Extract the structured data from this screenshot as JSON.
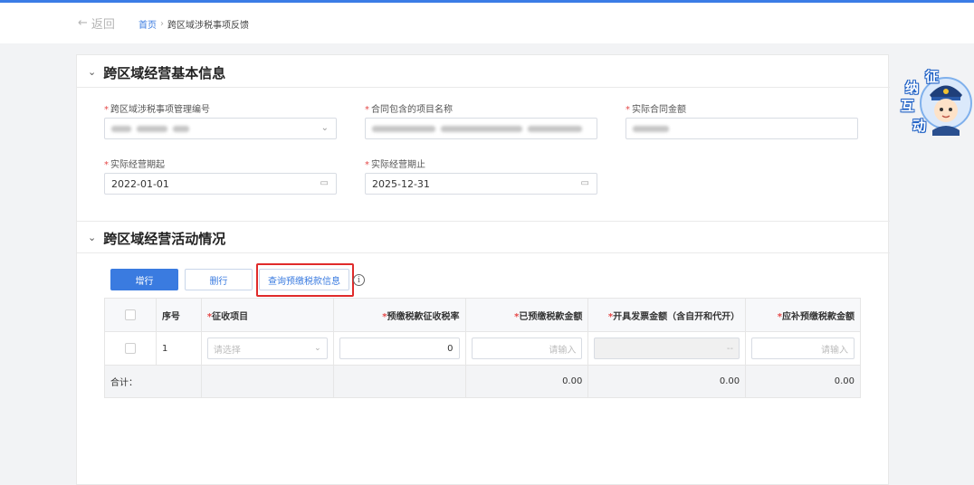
{
  "header": {
    "back_label": "返回",
    "breadcrumb": {
      "home": "首页",
      "separator": "›",
      "current": "跨区域涉税事项反馈"
    }
  },
  "section_basic": {
    "title": "跨区域经营基本信息",
    "fields": {
      "mgmt_no": {
        "label": "跨区域涉税事项管理编号",
        "value": ""
      },
      "project_name": {
        "label": "合同包含的项目名称",
        "value": ""
      },
      "contract_amount": {
        "label": "实际合同金额",
        "value": ""
      },
      "period_start": {
        "label": "实际经营期起",
        "value": "2022-01-01"
      },
      "period_end": {
        "label": "实际经营期止",
        "value": "2025-12-31"
      }
    }
  },
  "section_activity": {
    "title": "跨区域经营活动情况",
    "buttons": {
      "add": "增行",
      "delete": "删行",
      "query": "查询预缴税款信息"
    },
    "info_icon": "ⓘ",
    "table": {
      "headers": {
        "index": "序号",
        "item": "征收项目",
        "rate": "预缴税款征收税率",
        "prepaid": "已预缴税款金额",
        "invoice": "开具发票金额（含自开和代开）",
        "supplement": "应补预缴税款金额"
      },
      "required_mark": "*",
      "row": {
        "index": "1",
        "item_placeholder": "请选择",
        "rate": "0",
        "prepaid_placeholder": "请输入",
        "invoice": "--",
        "supplement_placeholder": "请输入"
      },
      "total": {
        "label": "合计：",
        "prepaid": "0.00",
        "invoice": "0.00",
        "supplement": "0.00"
      }
    }
  },
  "mascot": {
    "chars": [
      "征",
      "纳",
      "互",
      "动"
    ]
  },
  "colors": {
    "primary": "#3a7be0",
    "required": "#e54848",
    "highlight": "#e02b2b"
  }
}
